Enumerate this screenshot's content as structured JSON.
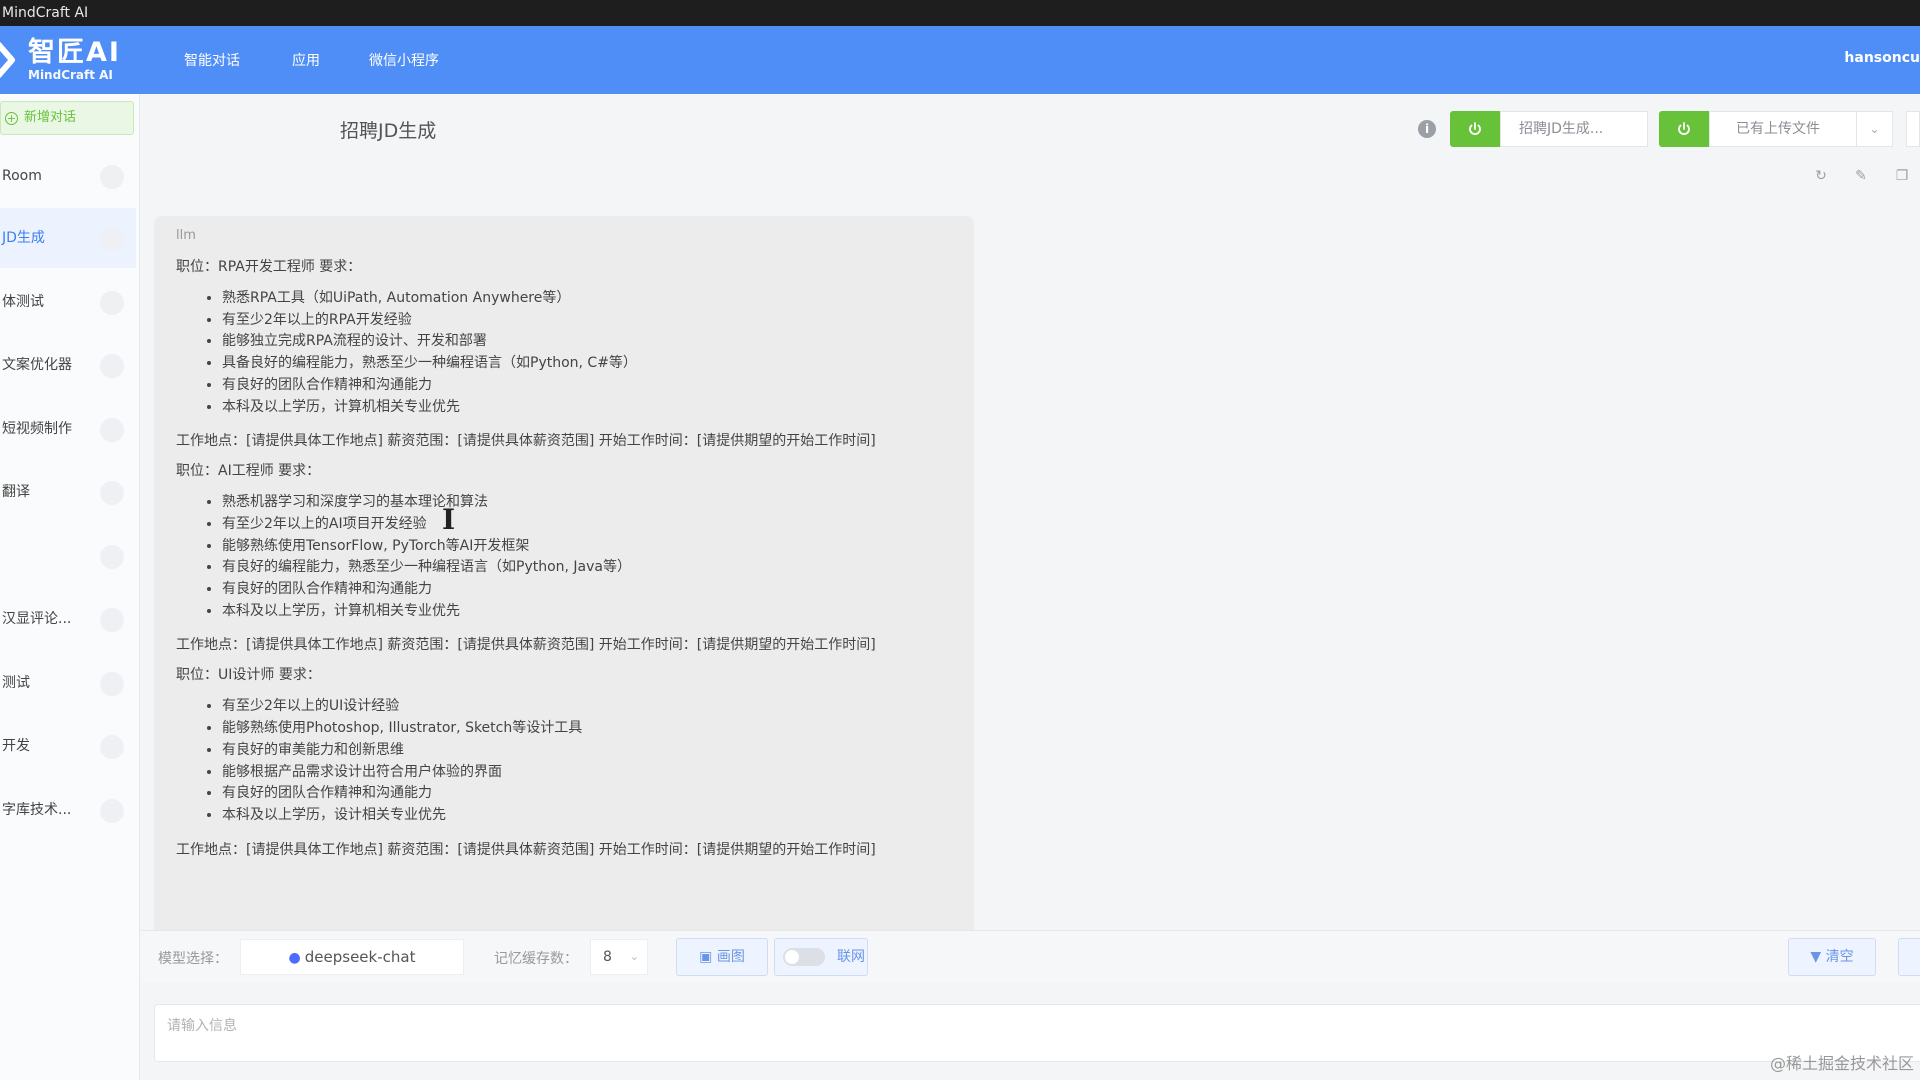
{
  "window": {
    "title": "MindCraft AI"
  },
  "brand": {
    "name_cn": "智匠AI",
    "name_en": "MindCraft AI",
    "color": "#4f8ef7"
  },
  "nav": {
    "items": [
      "智能对话",
      "应用",
      "微信小程序"
    ],
    "user": "hansoncu"
  },
  "sidebar": {
    "new_chat_label": "新增对话",
    "items": [
      {
        "label": "Room"
      },
      {
        "label": "JD生成",
        "active": true
      },
      {
        "label": "体测试"
      },
      {
        "label": "文案优化器"
      },
      {
        "label": "短视频制作"
      },
      {
        "label": "翻译"
      },
      {
        "label": ""
      },
      {
        "label": "汉显评论..."
      },
      {
        "label": "测试"
      },
      {
        "label": "开发"
      },
      {
        "label": "字库技术..."
      }
    ]
  },
  "header": {
    "title": "招聘JD生成",
    "info_icon": "info-icon",
    "app_select_value": "招聘JD生成...",
    "file_select_value": "已有上传文件",
    "accent_green": "#67c23a"
  },
  "message": {
    "sender": "llm",
    "cursor_glyph": "I",
    "sections": [
      {
        "title": "职位：RPA开发工程师 要求：",
        "items": [
          "熟悉RPA工具（如UiPath, Automation Anywhere等）",
          "有至少2年以上的RPA开发经验",
          "能够独立完成RPA流程的设计、开发和部署",
          "具备良好的编程能力，熟悉至少一种编程语言（如Python, C#等）",
          "有良好的团队合作精神和沟通能力",
          "本科及以上学历，计算机相关专业优先"
        ],
        "footer": "工作地点：[请提供具体工作地点] 薪资范围：[请提供具体薪资范围] 开始工作时间：[请提供期望的开始工作时间]"
      },
      {
        "title": "职位：AI工程师 要求：",
        "items": [
          "熟悉机器学习和深度学习的基本理论和算法",
          "有至少2年以上的AI项目开发经验",
          "能够熟练使用TensorFlow, PyTorch等AI开发框架",
          "有良好的编程能力，熟悉至少一种编程语言（如Python, Java等）",
          "有良好的团队合作精神和沟通能力",
          "本科及以上学历，计算机相关专业优先"
        ],
        "footer": "工作地点：[请提供具体工作地点] 薪资范围：[请提供具体薪资范围] 开始工作时间：[请提供期望的开始工作时间]"
      },
      {
        "title": "职位：UI设计师 要求：",
        "items": [
          "有至少2年以上的UI设计经验",
          "能够熟练使用Photoshop, Illustrator, Sketch等设计工具",
          "有良好的审美能力和创新思维",
          "能够根据产品需求设计出符合用户体验的界面",
          "有良好的团队合作精神和沟通能力",
          "本科及以上学历，设计相关专业优先"
        ],
        "footer": "工作地点：[请提供具体工作地点] 薪资范围：[请提供具体薪资范围] 开始工作时间：[请提供期望的开始工作时间]"
      }
    ]
  },
  "toolbar": {
    "model_label": "模型选择：",
    "model_value": "deepseek-chat",
    "memory_label": "记忆缓存数：",
    "memory_value": "8",
    "draw_label": "画图",
    "web_label": "联网",
    "clear_label": "清空"
  },
  "input": {
    "placeholder": "请输入信息"
  },
  "watermark": "@稀土掘金技术社区"
}
